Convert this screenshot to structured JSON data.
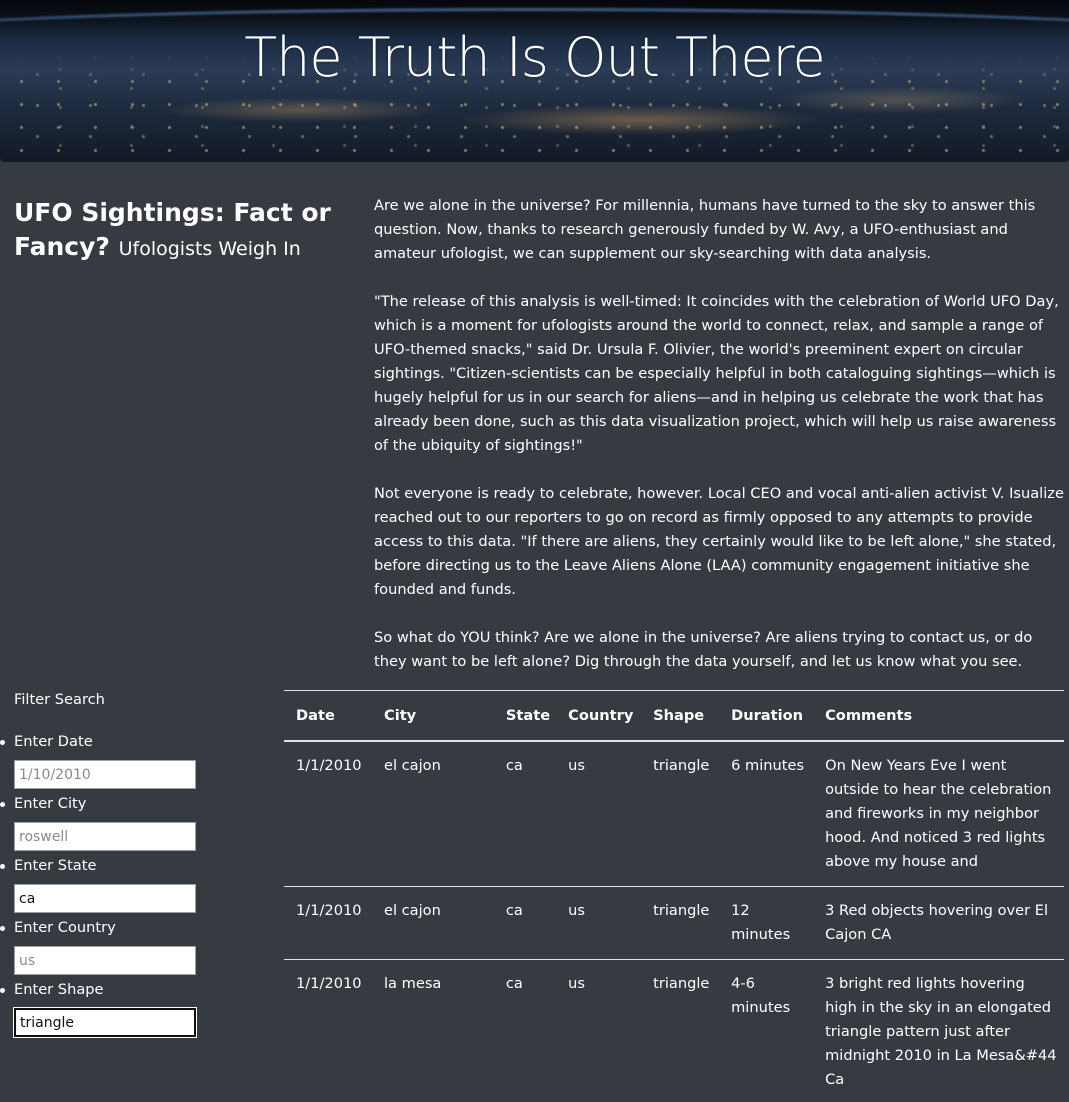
{
  "hero": {
    "title": "The Truth Is Out There"
  },
  "article": {
    "heading": "UFO Sightings: Fact or Fancy?",
    "subheading": "Ufologists Weigh In",
    "paragraphs": [
      "Are we alone in the universe? For millennia, humans have turned to the sky to answer this question. Now, thanks to research generously funded by W. Avy, a UFO-enthusiast and amateur ufologist, we can supplement our sky-searching with data analysis.",
      "\"The release of this analysis is well-timed: It coincides with the celebration of World UFO Day, which is a moment for ufologists around the world to connect, relax, and sample a range of UFO-themed snacks,\" said Dr. Ursula F. Olivier, the world's preeminent expert on circular sightings. \"Citizen-scientists can be especially helpful in both cataloguing sightings—which is hugely helpful for us in our search for aliens—and in helping us celebrate the work that has already been done, such as this data visualization project, which will help us raise awareness of the ubiquity of sightings!\"",
      "Not everyone is ready to celebrate, however. Local CEO and vocal anti-alien activist V. Isualize reached out to our reporters to go on record as firmly opposed to any attempts to provide access to this data. \"If there are aliens, they certainly would like to be left alone,\" she stated, before directing us to the Leave Aliens Alone (LAA) community engagement initiative she founded and funds.",
      "So what do YOU think? Are we alone in the universe? Are aliens trying to contact us, or do they want to be left alone? Dig through the data yourself, and let us know what you see."
    ]
  },
  "filters": {
    "title": "Filter Search",
    "date": {
      "label": "Enter Date",
      "value": "",
      "placeholder": "1/10/2010"
    },
    "city": {
      "label": "Enter City",
      "value": "",
      "placeholder": "roswell"
    },
    "state": {
      "label": "Enter State",
      "value": "ca",
      "placeholder": ""
    },
    "country": {
      "label": "Enter Country",
      "value": "",
      "placeholder": "us"
    },
    "shape": {
      "label": "Enter Shape",
      "value": "triangle",
      "placeholder": ""
    }
  },
  "table": {
    "headers": {
      "date": "Date",
      "city": "City",
      "state": "State",
      "country": "Country",
      "shape": "Shape",
      "duration": "Duration",
      "comments": "Comments"
    },
    "rows": [
      {
        "date": "1/1/2010",
        "city": "el cajon",
        "state": "ca",
        "country": "us",
        "shape": "triangle",
        "duration": "6 minutes",
        "comments": "On New Years Eve I went outside to hear the celebration and fireworks in my neighbor hood. And noticed 3 red lights above my house and"
      },
      {
        "date": "1/1/2010",
        "city": "el cajon",
        "state": "ca",
        "country": "us",
        "shape": "triangle",
        "duration": "12 minutes",
        "comments": "3 Red objects hovering over El Cajon CA"
      },
      {
        "date": "1/1/2010",
        "city": "la mesa",
        "state": "ca",
        "country": "us",
        "shape": "triangle",
        "duration": "4-6 minutes",
        "comments": "3 bright red lights hovering high in the sky in an elongated triangle pattern just after midnight 2010 in La Mesa&#44 Ca"
      }
    ]
  }
}
